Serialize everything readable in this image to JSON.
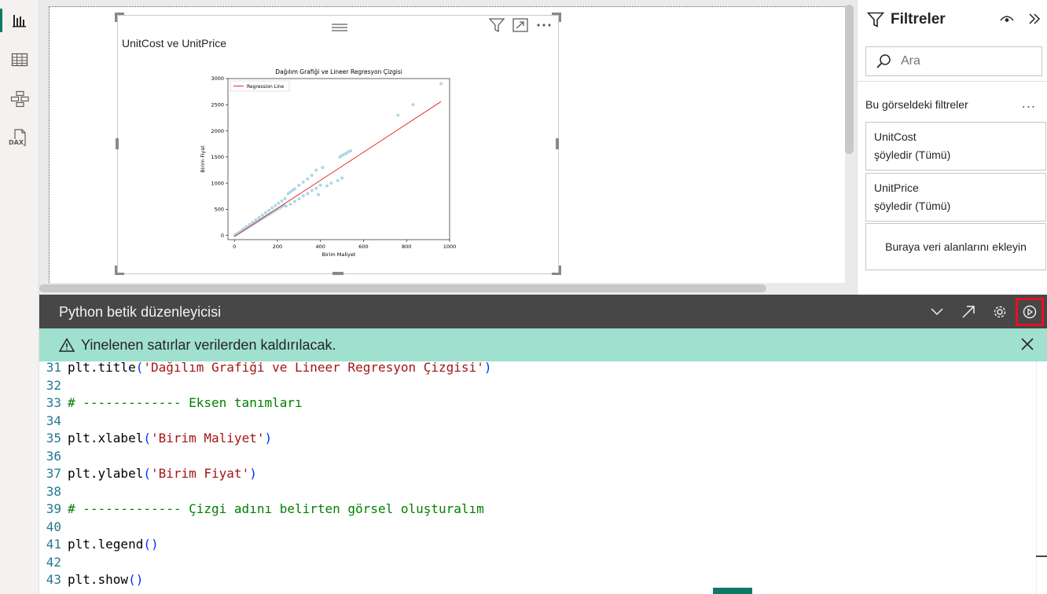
{
  "rail": {
    "items": [
      {
        "icon": "report-icon",
        "active": true
      },
      {
        "icon": "table-icon",
        "active": false
      },
      {
        "icon": "model-icon",
        "active": false
      },
      {
        "icon": "dax-icon",
        "label": "DAX",
        "active": false
      }
    ]
  },
  "visual": {
    "title": "UnitCost ve UnitPrice"
  },
  "chart_data": {
    "type": "scatter",
    "title": "Dağılım Grafiği ve Lineer Regresyon Çizgisi",
    "xlabel": "Birim Maliyet",
    "ylabel": "Birim Fiyat",
    "xlim": [
      -30,
      1000
    ],
    "ylim": [
      -80,
      3000
    ],
    "xticks": [
      0,
      200,
      400,
      600,
      800,
      1000
    ],
    "yticks": [
      0,
      500,
      1000,
      1500,
      2000,
      2500,
      3000
    ],
    "legend": {
      "position": "top-left",
      "entries": [
        "Regression Line"
      ]
    },
    "regression_line": {
      "name": "Regression Line",
      "color": "#e8262a",
      "x": [
        0,
        960
      ],
      "y": [
        -20,
        2560
      ]
    },
    "point_color": "#add8e6",
    "points": [
      [
        2,
        5
      ],
      [
        5,
        12
      ],
      [
        8,
        20
      ],
      [
        10,
        25
      ],
      [
        14,
        35
      ],
      [
        18,
        45
      ],
      [
        22,
        55
      ],
      [
        25,
        62
      ],
      [
        30,
        75
      ],
      [
        34,
        85
      ],
      [
        38,
        95
      ],
      [
        42,
        105
      ],
      [
        46,
        115
      ],
      [
        50,
        125
      ],
      [
        55,
        138
      ],
      [
        60,
        150
      ],
      [
        65,
        162
      ],
      [
        70,
        175
      ],
      [
        75,
        188
      ],
      [
        80,
        200
      ],
      [
        85,
        212
      ],
      [
        90,
        225
      ],
      [
        95,
        238
      ],
      [
        100,
        250
      ],
      [
        108,
        270
      ],
      [
        115,
        288
      ],
      [
        120,
        300
      ],
      [
        130,
        325
      ],
      [
        140,
        350
      ],
      [
        150,
        375
      ],
      [
        160,
        400
      ],
      [
        170,
        425
      ],
      [
        180,
        450
      ],
      [
        190,
        475
      ],
      [
        200,
        500
      ],
      [
        210,
        525
      ],
      [
        220,
        550
      ],
      [
        230,
        575
      ],
      [
        40,
        120
      ],
      [
        55,
        165
      ],
      [
        70,
        210
      ],
      [
        85,
        255
      ],
      [
        100,
        300
      ],
      [
        115,
        345
      ],
      [
        130,
        390
      ],
      [
        145,
        435
      ],
      [
        160,
        480
      ],
      [
        175,
        525
      ],
      [
        190,
        570
      ],
      [
        205,
        615
      ],
      [
        220,
        660
      ],
      [
        235,
        705
      ],
      [
        250,
        800
      ],
      [
        260,
        830
      ],
      [
        270,
        860
      ],
      [
        280,
        890
      ],
      [
        300,
        960
      ],
      [
        320,
        1020
      ],
      [
        340,
        1080
      ],
      [
        360,
        1150
      ],
      [
        380,
        1250
      ],
      [
        410,
        1300
      ],
      [
        240,
        560
      ],
      [
        260,
        600
      ],
      [
        280,
        650
      ],
      [
        300,
        700
      ],
      [
        320,
        760
      ],
      [
        340,
        800
      ],
      [
        360,
        860
      ],
      [
        380,
        900
      ],
      [
        400,
        960
      ],
      [
        390,
        780
      ],
      [
        430,
        950
      ],
      [
        450,
        1000
      ],
      [
        500,
        1100
      ],
      [
        480,
        1050
      ],
      [
        490,
        1500
      ],
      [
        500,
        1530
      ],
      [
        510,
        1550
      ],
      [
        520,
        1570
      ],
      [
        530,
        1600
      ],
      [
        540,
        1620
      ],
      [
        760,
        2300
      ],
      [
        830,
        2500
      ],
      [
        960,
        2900
      ]
    ]
  },
  "filters": {
    "title": "Filtreler",
    "search_placeholder": "Ara",
    "section_label": "Bu görseldeki filtreler",
    "more_label": "...",
    "cards": [
      {
        "field": "UnitCost",
        "state": "şöyledir (Tümü)"
      },
      {
        "field": "UnitPrice",
        "state": "şöyledir (Tümü)"
      }
    ],
    "drop_label": "Buraya veri alanlarını ekleyin"
  },
  "editor": {
    "title": "Python betik düzenleyicisi",
    "banner": "Yinelenen satırlar verilerden kaldırılacak.",
    "lines": [
      {
        "n": "31",
        "parts": [
          [
            "fn",
            "plt.title"
          ],
          [
            "p",
            "("
          ],
          [
            "str",
            "'Dağılım Grafiği ve Lineer Regresyon Çizgisi'"
          ],
          [
            "p",
            ")"
          ]
        ]
      },
      {
        "n": "32",
        "parts": []
      },
      {
        "n": "33",
        "parts": [
          [
            "com",
            "# ------------- Eksen tanımları"
          ]
        ]
      },
      {
        "n": "34",
        "parts": []
      },
      {
        "n": "35",
        "parts": [
          [
            "fn",
            "plt.xlabel"
          ],
          [
            "p",
            "("
          ],
          [
            "str",
            "'Birim Maliyet'"
          ],
          [
            "p",
            ")"
          ]
        ]
      },
      {
        "n": "36",
        "parts": []
      },
      {
        "n": "37",
        "parts": [
          [
            "fn",
            "plt.ylabel"
          ],
          [
            "p",
            "("
          ],
          [
            "str",
            "'Birim Fiyat'"
          ],
          [
            "p",
            ")"
          ]
        ]
      },
      {
        "n": "38",
        "parts": []
      },
      {
        "n": "39",
        "parts": [
          [
            "com",
            "# ------------- Çizgi adını belirten görsel oluşturalım"
          ]
        ]
      },
      {
        "n": "40",
        "parts": []
      },
      {
        "n": "41",
        "parts": [
          [
            "fn",
            "plt.legend"
          ],
          [
            "p",
            "()"
          ]
        ]
      },
      {
        "n": "42",
        "parts": []
      },
      {
        "n": "43",
        "parts": [
          [
            "fn",
            "plt.show"
          ],
          [
            "p",
            "()"
          ]
        ]
      }
    ]
  }
}
